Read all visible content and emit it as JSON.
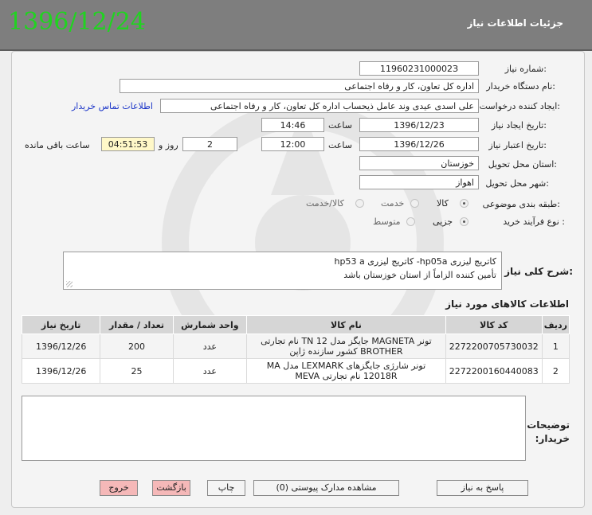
{
  "header": {
    "date": "1396/12/24",
    "title": "جزئیات اطلاعات نیاز"
  },
  "form": {
    "need_number_label": "شماره نیاز:",
    "need_number": "1196023100002З",
    "buyer_org_label": "نام دستگاه خریدار:",
    "buyer_org": "اداره کل تعاون، کار و رفاه اجتماعی",
    "requester_label": "ایجاد کننده درخواست:",
    "requester": "علی اسدی عیدی وند عامل ذیحساب اداره کل تعاون، کار و رفاه اجتماعی",
    "buyer_contact_link": "اطلاعات تماس خریدار",
    "created_date_label": "تاریخ ایجاد نیاز:",
    "created_date": "1396/12/23",
    "created_time_label": "ساعت",
    "created_time": "14:46",
    "validity_date_label": "تاریخ اعتبار نیاز:",
    "validity_date": "1396/12/26",
    "validity_time_label": "ساعت",
    "validity_time": "12:00",
    "days_remaining": "2",
    "days_label": "روز و",
    "time_remaining": "04:51:53",
    "time_remaining_label": "ساعت باقی مانده",
    "delivery_province_label": "استان محل تحویل:",
    "delivery_province": "خوزستان",
    "delivery_city_label": "شهر محل تحویل:",
    "delivery_city": "اهواز",
    "category_label": "طبقه بندی موضوعی:",
    "category_options": [
      "کالا",
      "خدمت",
      "کالا/خدمت"
    ],
    "category_selected": "کالا",
    "purchase_type_label": "نوع فرآیند خرید :",
    "purchase_type_options": [
      "جزیی",
      "متوسط"
    ],
    "purchase_type_selected": "جزیی",
    "summary_label": "شرح کلی نیاز:",
    "summary_line1": "کاتریج لیزری hp05a- کاتریج لیزری hp53 a",
    "summary_line2": "تأمین کننده الزاماً از استان خوزستان باشد"
  },
  "goods": {
    "section_title": "اطلاعات کالاهای مورد نیاز",
    "columns": [
      "ردیف",
      "کد کالا",
      "نام کالا",
      "واحد شمارش",
      "تعداد / مقدار",
      "تاریخ نیاز"
    ],
    "rows": [
      {
        "row": "1",
        "code": "2272200705730032",
        "name": "تونر MAGNETA جایگز مدل 12 TN نام تجارتی BROTHER کشور سازنده ژاپن",
        "unit": "عدد",
        "qty": "200",
        "date": "1396/12/26"
      },
      {
        "row": "2",
        "code": "2272200160440083",
        "name": "تونر شارژی جایگزهای LEXMARK مدل MA 12018R نام تجارتی MEVA",
        "unit": "عدد",
        "qty": "25",
        "date": "1396/12/26"
      }
    ]
  },
  "notes": {
    "label": "توضیحات خریدار:"
  },
  "buttons": {
    "reply": "پاسخ به نیاز",
    "attachments": "مشاهده مدارک پیوستی (0)",
    "print": "چاپ",
    "back": "بازگشت",
    "exit": "خروج"
  }
}
